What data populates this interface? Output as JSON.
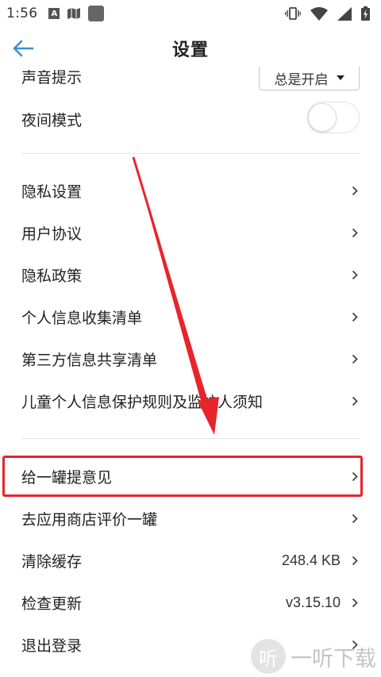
{
  "status_bar": {
    "time": "1:56",
    "left_icons": [
      "a-notification-icon",
      "map-notification-icon",
      "app-notification-icon"
    ],
    "right_icons": [
      "vibrate-icon",
      "wifi-icon",
      "signal-icon",
      "battery-charging-icon"
    ]
  },
  "header": {
    "title": "设置",
    "back_icon": "back-arrow-icon",
    "accent_color": "#3b8de0"
  },
  "settings": {
    "sound": {
      "label": "声音提示",
      "value": "总是开启"
    },
    "night_mode": {
      "label": "夜间模式",
      "enabled": false
    },
    "items": [
      {
        "label": "隐私设置",
        "value": ""
      },
      {
        "label": "用户协议",
        "value": ""
      },
      {
        "label": "隐私政策",
        "value": ""
      },
      {
        "label": "个人信息收集清单",
        "value": ""
      },
      {
        "label": "第三方信息共享清单",
        "value": ""
      },
      {
        "label": "儿童个人信息保护规则及监护人须知",
        "value": ""
      }
    ],
    "items2": [
      {
        "label": "给一罐提意见",
        "value": ""
      },
      {
        "label": "去应用商店评价一罐",
        "value": ""
      },
      {
        "label": "清除缓存",
        "value": "248.4 KB"
      },
      {
        "label": "检查更新",
        "value": "v3.15.10"
      },
      {
        "label": "退出登录",
        "value": ""
      }
    ]
  },
  "annotation": {
    "highlight_color": "#e8242b"
  },
  "watermark": {
    "text": "一听下载",
    "icon_text": "听"
  }
}
